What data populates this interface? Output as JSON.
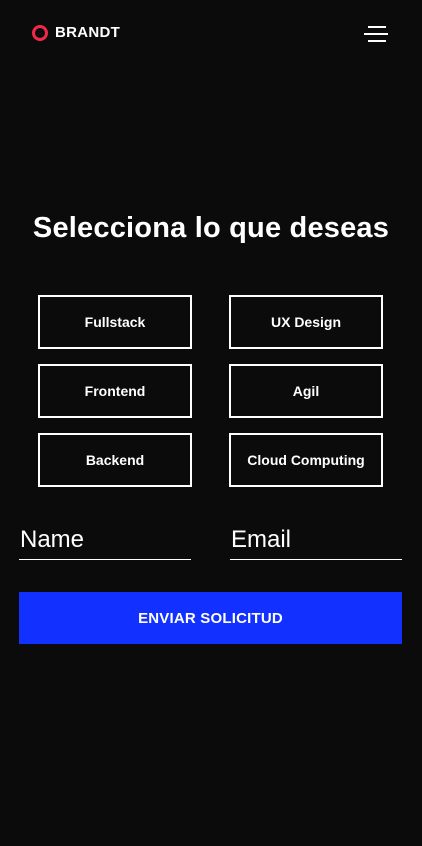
{
  "header": {
    "brand_name": "BRANDT",
    "brand_ring_color": "#f0284a",
    "menu_icon": "hamburger-menu-icon"
  },
  "main": {
    "title": "Selecciona lo que deseas",
    "options": [
      {
        "label": "Fullstack"
      },
      {
        "label": "UX Design"
      },
      {
        "label": "Frontend"
      },
      {
        "label": "Agil"
      },
      {
        "label": "Backend"
      },
      {
        "label": "Cloud Computing"
      }
    ]
  },
  "form": {
    "name_placeholder": "Name",
    "name_value": "",
    "email_placeholder": "Email",
    "email_value": "",
    "submit_label": "ENVIAR SOLICITUD",
    "submit_color": "#1230ff"
  },
  "colors": {
    "background": "#0b0b0b",
    "text": "#ffffff"
  }
}
